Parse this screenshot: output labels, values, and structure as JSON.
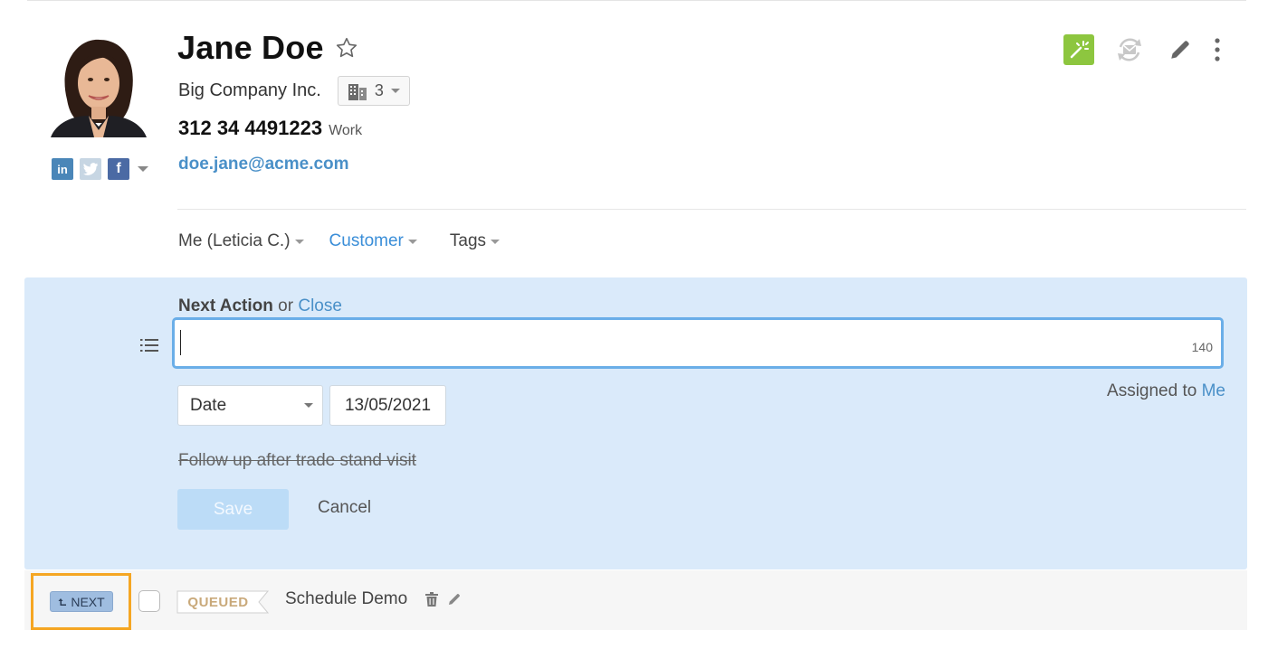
{
  "contact": {
    "name": "Jane Doe",
    "company": "Big Company Inc.",
    "company_count": "3",
    "phone": "312 34 4491223",
    "phone_type": "Work",
    "email": "doe.jane@acme.com"
  },
  "social": {
    "linkedin": "in",
    "facebook": "f"
  },
  "meta": {
    "owner": "Me (Leticia C.)",
    "status": "Customer",
    "tags": "Tags"
  },
  "next_action": {
    "title": "Next Action",
    "or_text": "or",
    "close_link": "Close",
    "input_value": "",
    "char_counter": "140",
    "date_mode": "Date",
    "date_value": "13/05/2021",
    "assigned_prefix": "Assigned to",
    "assigned_to": "Me",
    "suggestion": "Follow up after trade stand visit",
    "save_label": "Save",
    "cancel_label": "Cancel"
  },
  "queue": {
    "next_label": "NEXT",
    "queued_label": "QUEUED",
    "task_title": "Schedule Demo"
  },
  "colors": {
    "accent_blue": "#4a90c8",
    "magic_green": "#8dc63f",
    "panel_bg": "#daeafa",
    "highlight_orange": "#f5a623"
  },
  "icons": {
    "favorite": "star-outline-icon",
    "company": "building-icon",
    "magic": "magic-wand-icon",
    "sync": "email-sync-icon",
    "edit": "pencil-icon",
    "more": "vertical-dots-icon",
    "list": "list-icon",
    "delete": "trash-icon"
  }
}
